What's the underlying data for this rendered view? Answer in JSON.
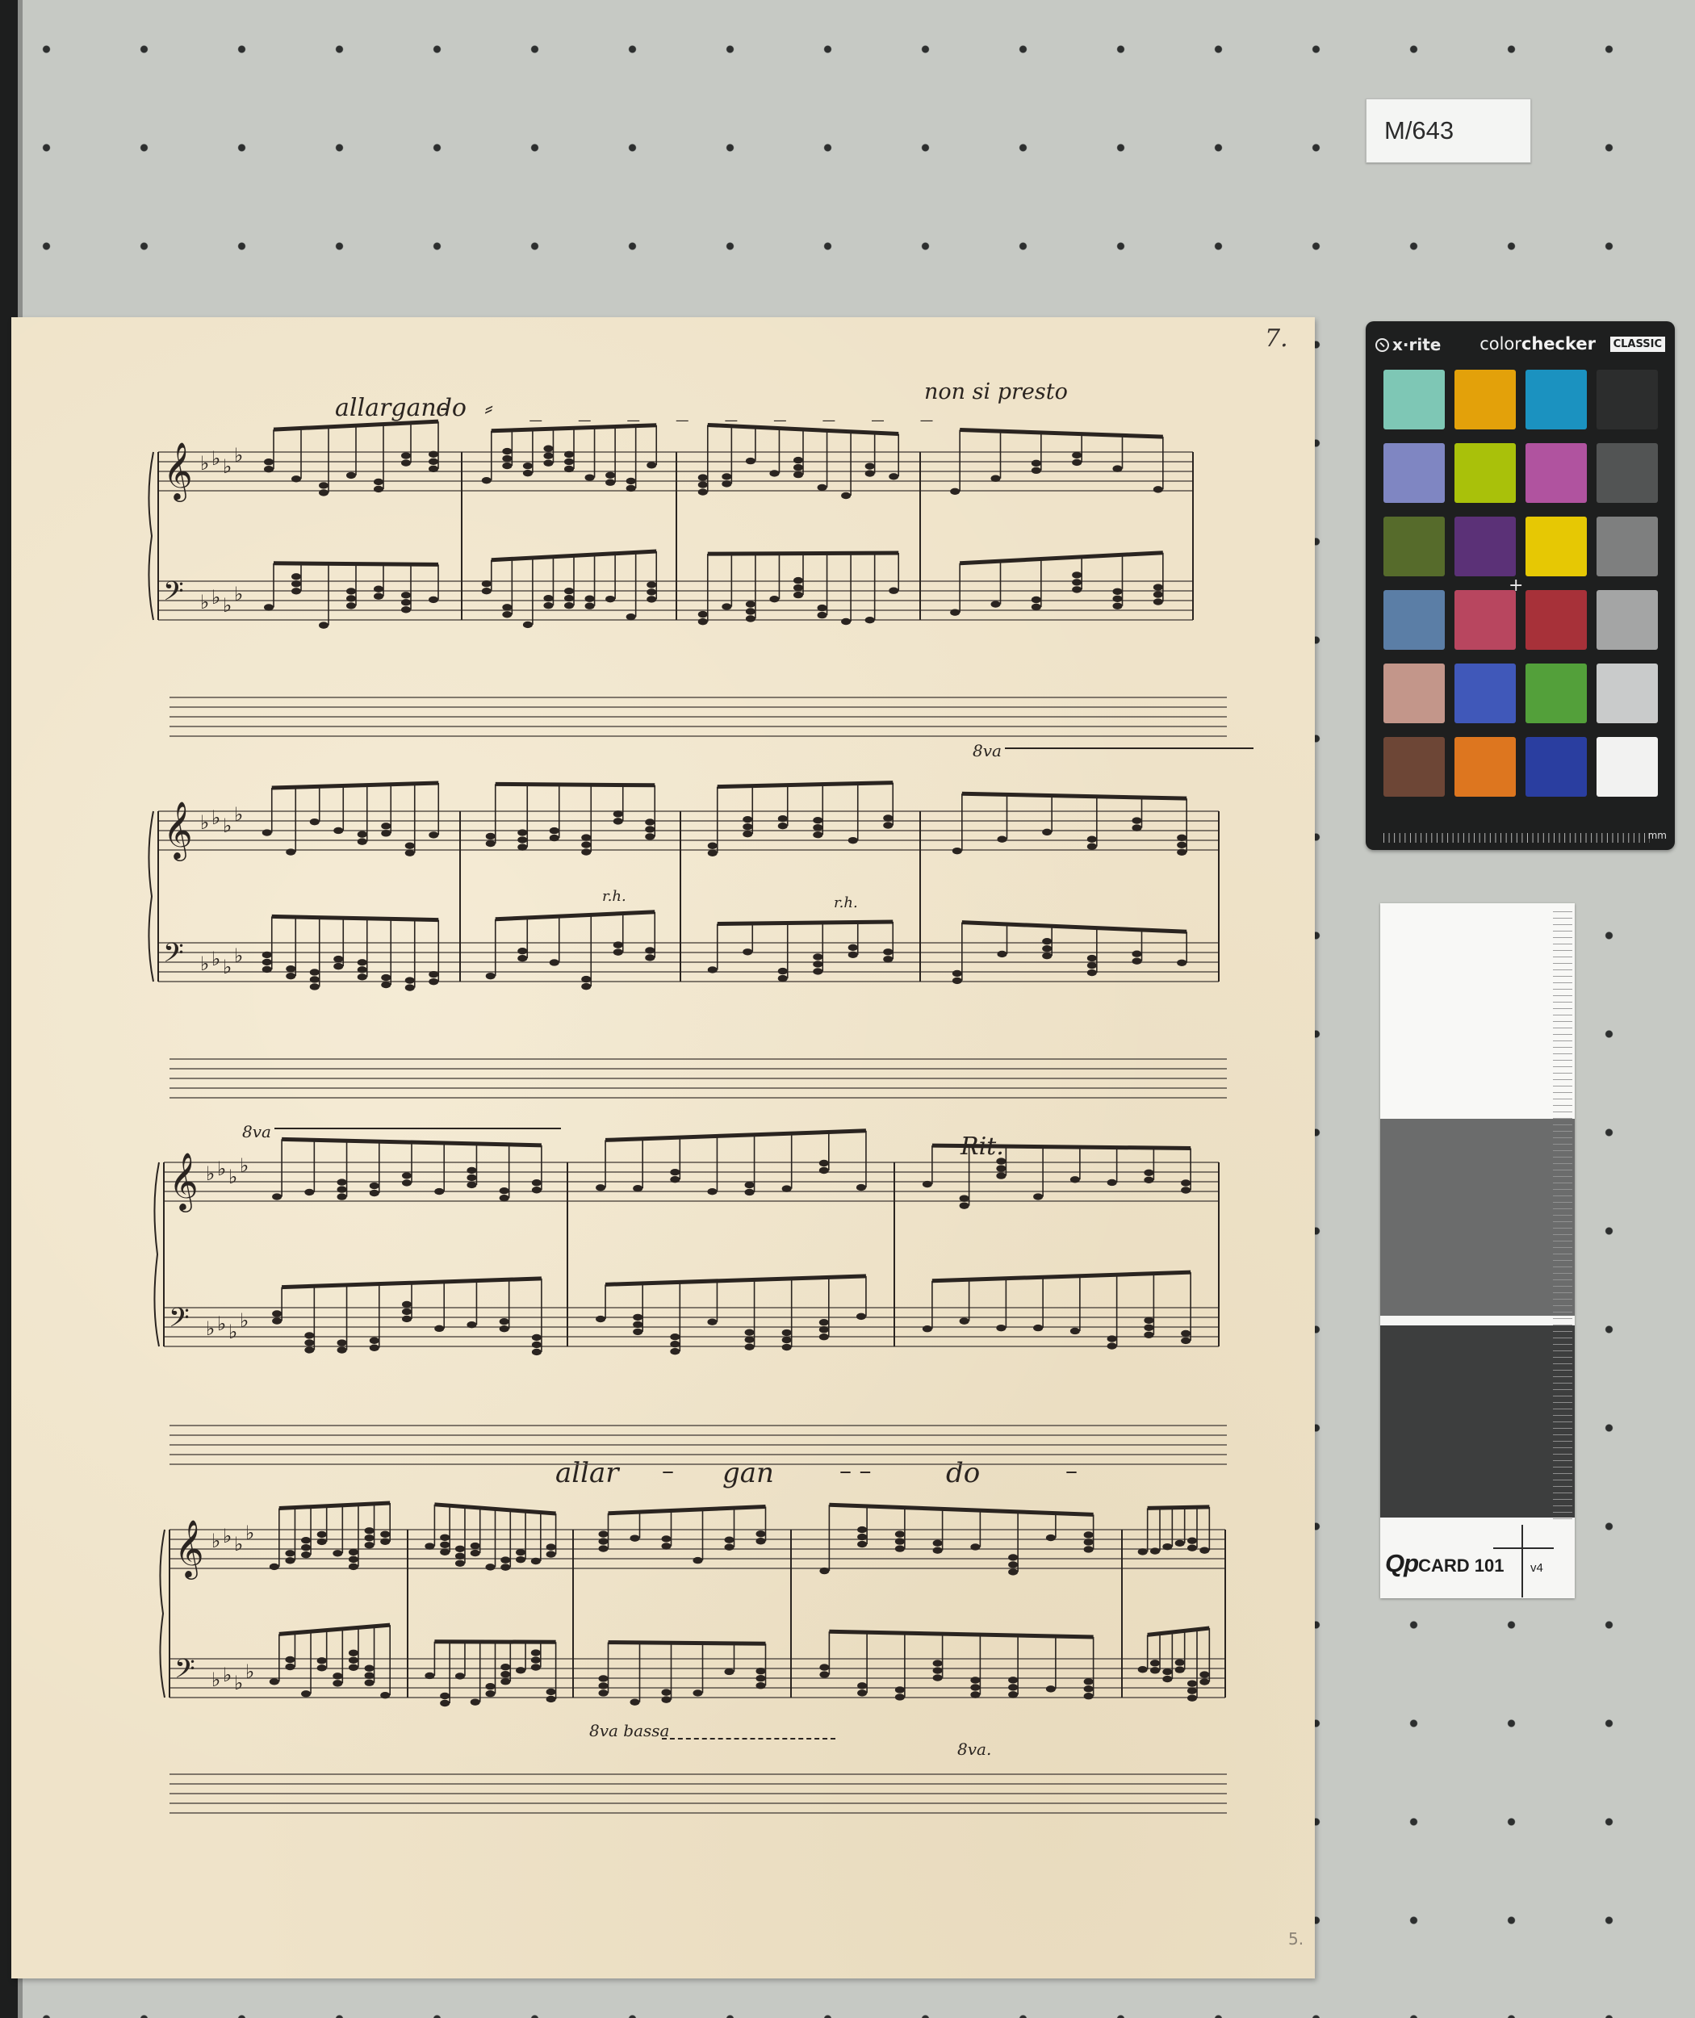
{
  "catalog_label": "M/643",
  "manuscript": {
    "page_number": "7.",
    "folio": "5.",
    "directions": {
      "allargando": "allargando",
      "allargando_dashes": "- ⸗ _ _ _ _ _ _ _ _ _",
      "non_si_presto": "non si presto",
      "ottava_1": "8va",
      "ottava_2": "8va",
      "rit": "Rit.",
      "allar": "allar",
      "gan": "gan",
      "do": "do",
      "ottava_bassa": "8va bassa",
      "ottava_low": "8va.",
      "rh_1": "r.h.",
      "rh_2": "r.h."
    }
  },
  "colorchecker": {
    "brand": "x·rite",
    "product_prefix": "color",
    "product_bold": "checker",
    "edition": "CLASSIC",
    "unit": "mm",
    "patches": [
      "#7ec7b5",
      "#e3a10a",
      "#1b92c0",
      "#2c2d2d",
      "#7f86c2",
      "#a9c10a",
      "#b0539f",
      "#525454",
      "#566b2b",
      "#5b3177",
      "#e6c804",
      "#7e7f7f",
      "#5b7ea6",
      "#b8465f",
      "#a73139",
      "#a4a5a5",
      "#c3968a",
      "#4058b9",
      "#53a03a",
      "#c9cbcb",
      "#6d4636",
      "#dd761f",
      "#2a3ea0",
      "#f2f2f1"
    ]
  },
  "qpcard": {
    "logo_bold": "Qp",
    "logo_rest": "CARD 101",
    "version": "v4"
  }
}
